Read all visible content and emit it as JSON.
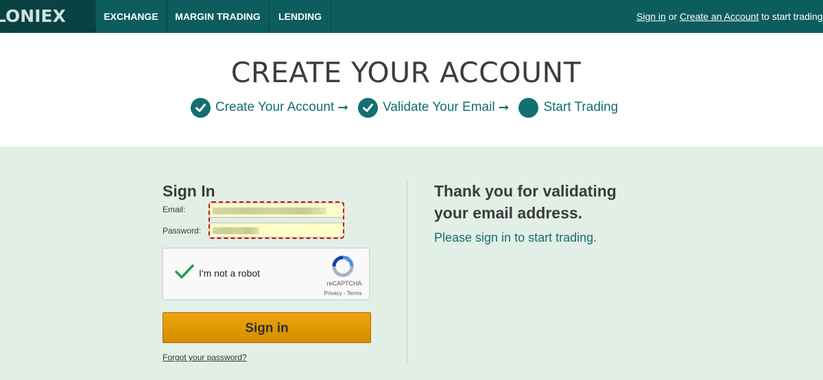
{
  "nav": {
    "logo_text": "LONIEX",
    "items": [
      {
        "label": "EXCHANGE"
      },
      {
        "label": "MARGIN TRADING"
      },
      {
        "label": "LENDING"
      }
    ],
    "signin_link": "Sign in",
    "or_text": " or ",
    "create_link": "Create an Account",
    "suffix_text": " to start trading"
  },
  "header": {
    "title": "CREATE YOUR ACCOUNT",
    "steps": [
      {
        "label": "Create Your Account",
        "state": "done"
      },
      {
        "label": "Validate Your Email",
        "state": "done"
      },
      {
        "label": "Start Trading",
        "state": "current"
      }
    ],
    "arrow": "➞"
  },
  "signin": {
    "title": "Sign In",
    "email_label": "Email:",
    "password_label": "Password:",
    "captcha": {
      "label": "I'm not a robot",
      "brand": "reCAPTCHA",
      "terms": "Privacy - Terms",
      "checked": true
    },
    "button_label": "Sign in",
    "forgot_link": "Forgot your password?"
  },
  "message": {
    "heading": "Thank you for validating your email address.",
    "subtext": "Please sign in to start trading."
  },
  "colors": {
    "nav_bg": "#0d5d5e",
    "accent": "#136f70",
    "content_bg": "#e2efe6",
    "button": "#e09800",
    "highlight": "#cc1111"
  }
}
